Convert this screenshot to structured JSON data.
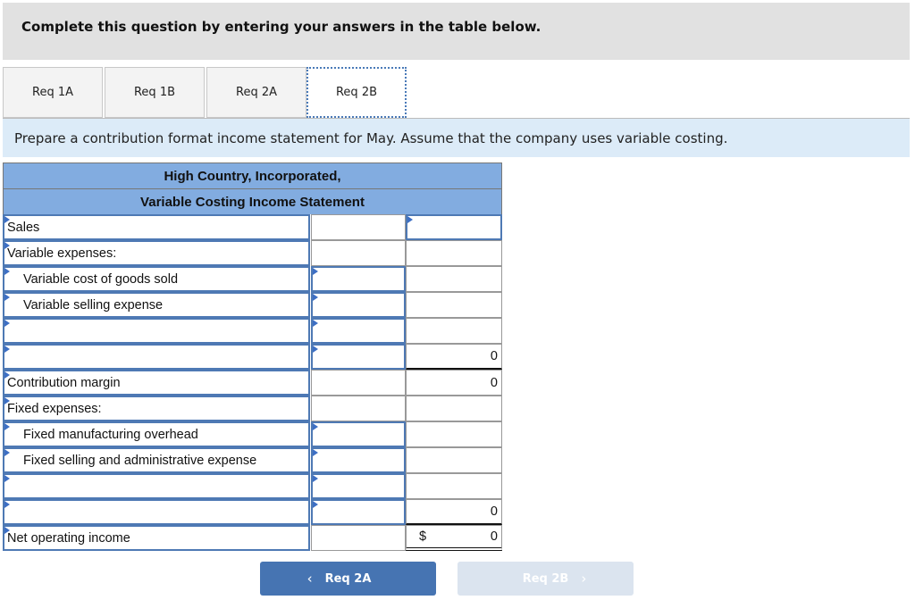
{
  "banner": {
    "text": "Complete this question by entering your answers in the table below."
  },
  "tabs": [
    {
      "label": "Req 1A",
      "active": false
    },
    {
      "label": "Req 1B",
      "active": false
    },
    {
      "label": "Req 2A",
      "active": false
    },
    {
      "label": "Req 2B",
      "active": true
    }
  ],
  "instruction": "Prepare a contribution format income statement for May. Assume that the company uses variable costing.",
  "statement": {
    "title": "High Country, Incorporated,",
    "subtitle": "Variable Costing Income Statement",
    "rows": [
      {
        "label": "Sales",
        "col2": "",
        "col3": ""
      },
      {
        "label": "Variable expenses:",
        "col2": "",
        "col3": ""
      },
      {
        "label": "Variable cost of goods sold",
        "col2": "",
        "col3": ""
      },
      {
        "label": "Variable selling expense",
        "col2": "",
        "col3": ""
      },
      {
        "label": "",
        "col2": "",
        "col3": ""
      },
      {
        "label": "",
        "col2": "",
        "col3": "0"
      },
      {
        "label": "Contribution margin",
        "col2": "",
        "col3": "0"
      },
      {
        "label": "Fixed expenses:",
        "col2": "",
        "col3": ""
      },
      {
        "label": "Fixed manufacturing overhead",
        "col2": "",
        "col3": ""
      },
      {
        "label": "Fixed selling and administrative expense",
        "col2": "",
        "col3": ""
      },
      {
        "label": "",
        "col2": "",
        "col3": ""
      },
      {
        "label": "",
        "col2": "",
        "col3": "0"
      },
      {
        "label": "Net operating income",
        "col2": "",
        "col3": "0",
        "currency": "$"
      }
    ]
  },
  "nav": {
    "prev_label": "Req 2A",
    "next_label": "Req 2B",
    "prev_icon": "chevron-left",
    "next_icon": "chevron-right"
  }
}
